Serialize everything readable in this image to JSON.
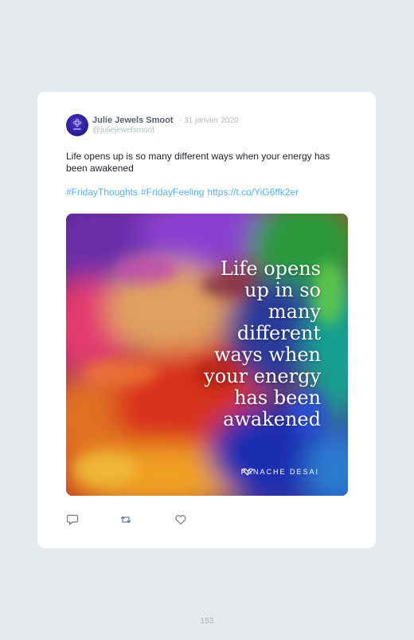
{
  "tweet": {
    "author_name": "Julie Jewels Smoot",
    "separator": "·",
    "date": "31 janvier 2020",
    "handle": "@juliejewelsmoot",
    "text": "Life opens up is so many different ways when your energy has been awakened",
    "hashtags": [
      "#FridayThoughts",
      "#FridayFeeling"
    ],
    "link": "https://t.co/YiG6ffk2er",
    "media": {
      "quote_lines": [
        "Life opens",
        "up in so",
        "many",
        "different",
        "ways when",
        "your energy",
        "has been",
        "awakened"
      ],
      "brand": "PANACHE DESAI"
    }
  },
  "actions": {
    "reply_icon": "reply-icon",
    "retweet_icon": "retweet-icon",
    "like_icon": "heart-icon"
  },
  "page": {
    "number": "153"
  },
  "colors": {
    "background": "#e5eaee",
    "card": "#ffffff",
    "link": "#5ab0e8",
    "muted": "#b3bcc5",
    "name": "#556270"
  }
}
